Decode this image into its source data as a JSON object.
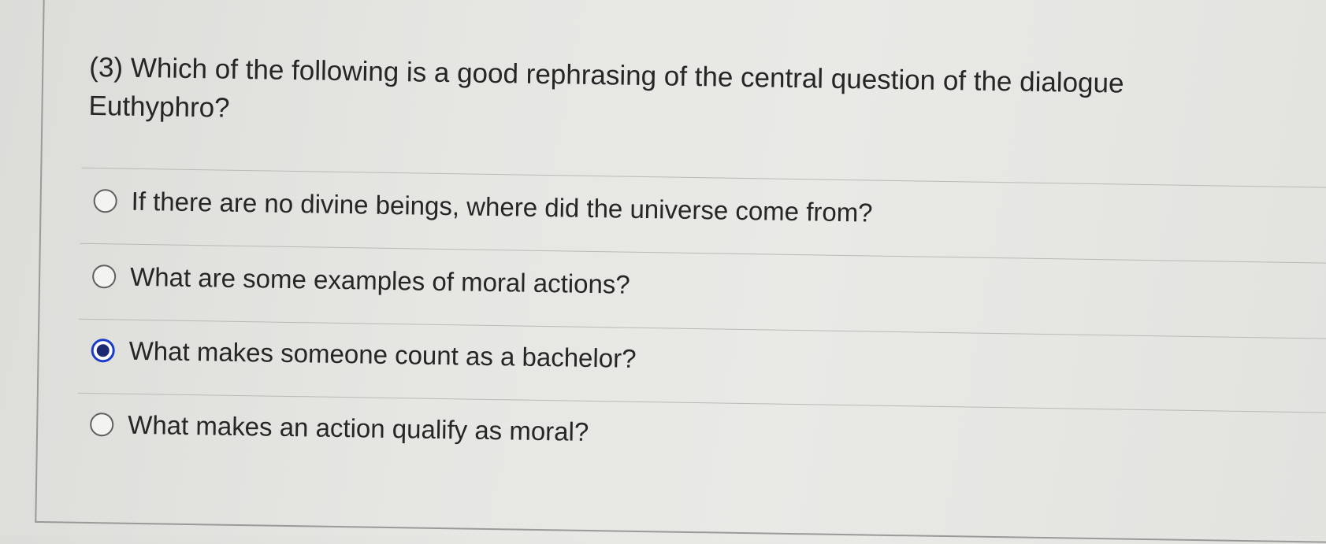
{
  "question": {
    "text": "(3) Which of the following is a good rephrasing of the central question of the dialogue Euthyphro?"
  },
  "options": [
    {
      "label": "If there are no divine beings, where did the universe come from?",
      "selected": false
    },
    {
      "label": "What are some examples of moral actions?",
      "selected": false
    },
    {
      "label": "What makes someone count as a bachelor?",
      "selected": true
    },
    {
      "label": "What makes an action qualify as moral?",
      "selected": false
    }
  ],
  "colors": {
    "selected_radio": "#1b3cc9",
    "text": "#262626",
    "divider": "#b9b9b6"
  }
}
